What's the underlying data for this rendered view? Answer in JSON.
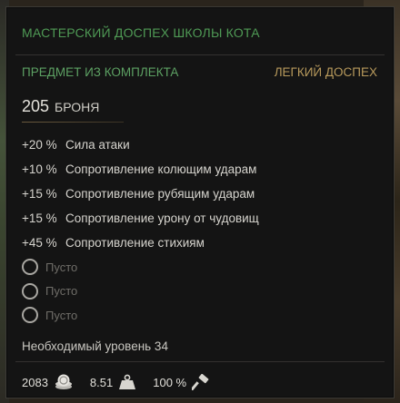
{
  "item": {
    "title": "МАСТЕРСКИЙ ДОСПЕХ ШКОЛЫ КОТА",
    "set_label": "ПРЕДМЕТ ИЗ КОМПЛЕКТА",
    "armor_type": "ЛЕГКИЙ ДОСПЕХ",
    "armor_value": "205",
    "armor_label": "БРОНЯ"
  },
  "stats": [
    {
      "value": "+20 %",
      "label": "Сила атаки"
    },
    {
      "value": "+10 %",
      "label": "Сопротивление колющим ударам"
    },
    {
      "value": "+15 %",
      "label": "Сопротивление рубящим ударам"
    },
    {
      "value": "+15 %",
      "label": "Сопротивление урону от чудовищ"
    },
    {
      "value": "+45 %",
      "label": "Сопротивление стихиям"
    }
  ],
  "slots": [
    {
      "label": "Пусто"
    },
    {
      "label": "Пусто"
    },
    {
      "label": "Пусто"
    }
  ],
  "requirement": "Необходимый уровень 34",
  "footer": {
    "price": "2083",
    "price_icon": "coin-icon",
    "weight": "8.51",
    "weight_icon": "weight-icon",
    "durability": "100 %",
    "durability_icon": "hammer-icon"
  },
  "colors": {
    "title_green": "#4f9a55",
    "set_green": "#5da163",
    "armor_type_gold": "#b89a5c",
    "empty_slot_grey": "#6f6d68"
  }
}
